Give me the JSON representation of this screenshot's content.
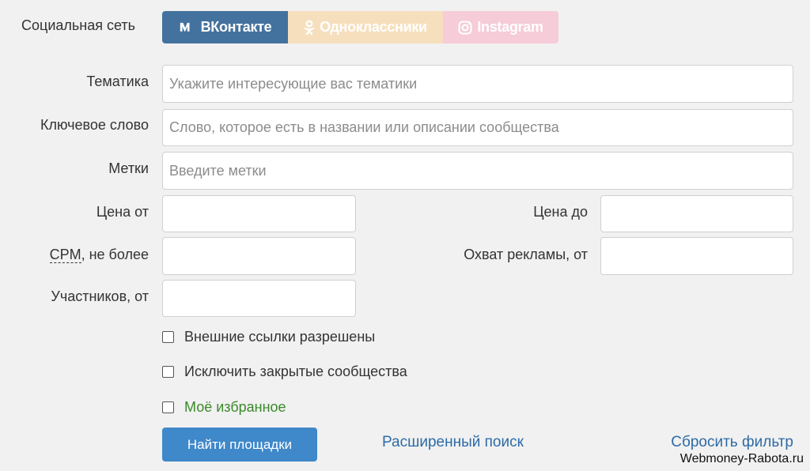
{
  "social": {
    "label": "Социальная сеть",
    "tabs": [
      {
        "label": "ВКонтакте",
        "icon": "vk-icon"
      },
      {
        "label": "Одноклассники",
        "icon": "odnoklassniki-icon"
      },
      {
        "label": "Instagram",
        "icon": "instagram-icon"
      }
    ]
  },
  "fields": {
    "topic": {
      "label": "Тематика",
      "placeholder": "Укажите интересующие вас тематики"
    },
    "keyword": {
      "label": "Ключевое слово",
      "placeholder": "Слово, которое есть в названии или описании сообщества"
    },
    "tags": {
      "label": "Метки",
      "placeholder": "Введите метки"
    },
    "price_from": {
      "label": "Цена от",
      "value": ""
    },
    "price_to": {
      "label": "Цена до",
      "value": ""
    },
    "cpm": {
      "abbr": "CPM",
      "label_rest": ", не более",
      "value": ""
    },
    "reach": {
      "label": "Охват рекламы, от",
      "value": ""
    },
    "members": {
      "label": "Участников, от",
      "value": ""
    }
  },
  "checkboxes": [
    {
      "label": "Внешние ссылки разрешены",
      "checked": false
    },
    {
      "label": "Исключить закрытые сообщества",
      "checked": false
    },
    {
      "label": "Моё избранное",
      "checked": false
    }
  ],
  "actions": {
    "search": "Найти площадки",
    "advanced": "Расширенный поиск",
    "reset": "Сбросить фильтр"
  },
  "watermark": "Webmoney-Rabota.ru",
  "colors": {
    "vk": "#44729e",
    "ok": "#f6dfbd",
    "instagram": "#f5ccd8",
    "primary": "#3f88c9",
    "link": "#2d6ba6",
    "favorite": "#3a8a2a"
  }
}
